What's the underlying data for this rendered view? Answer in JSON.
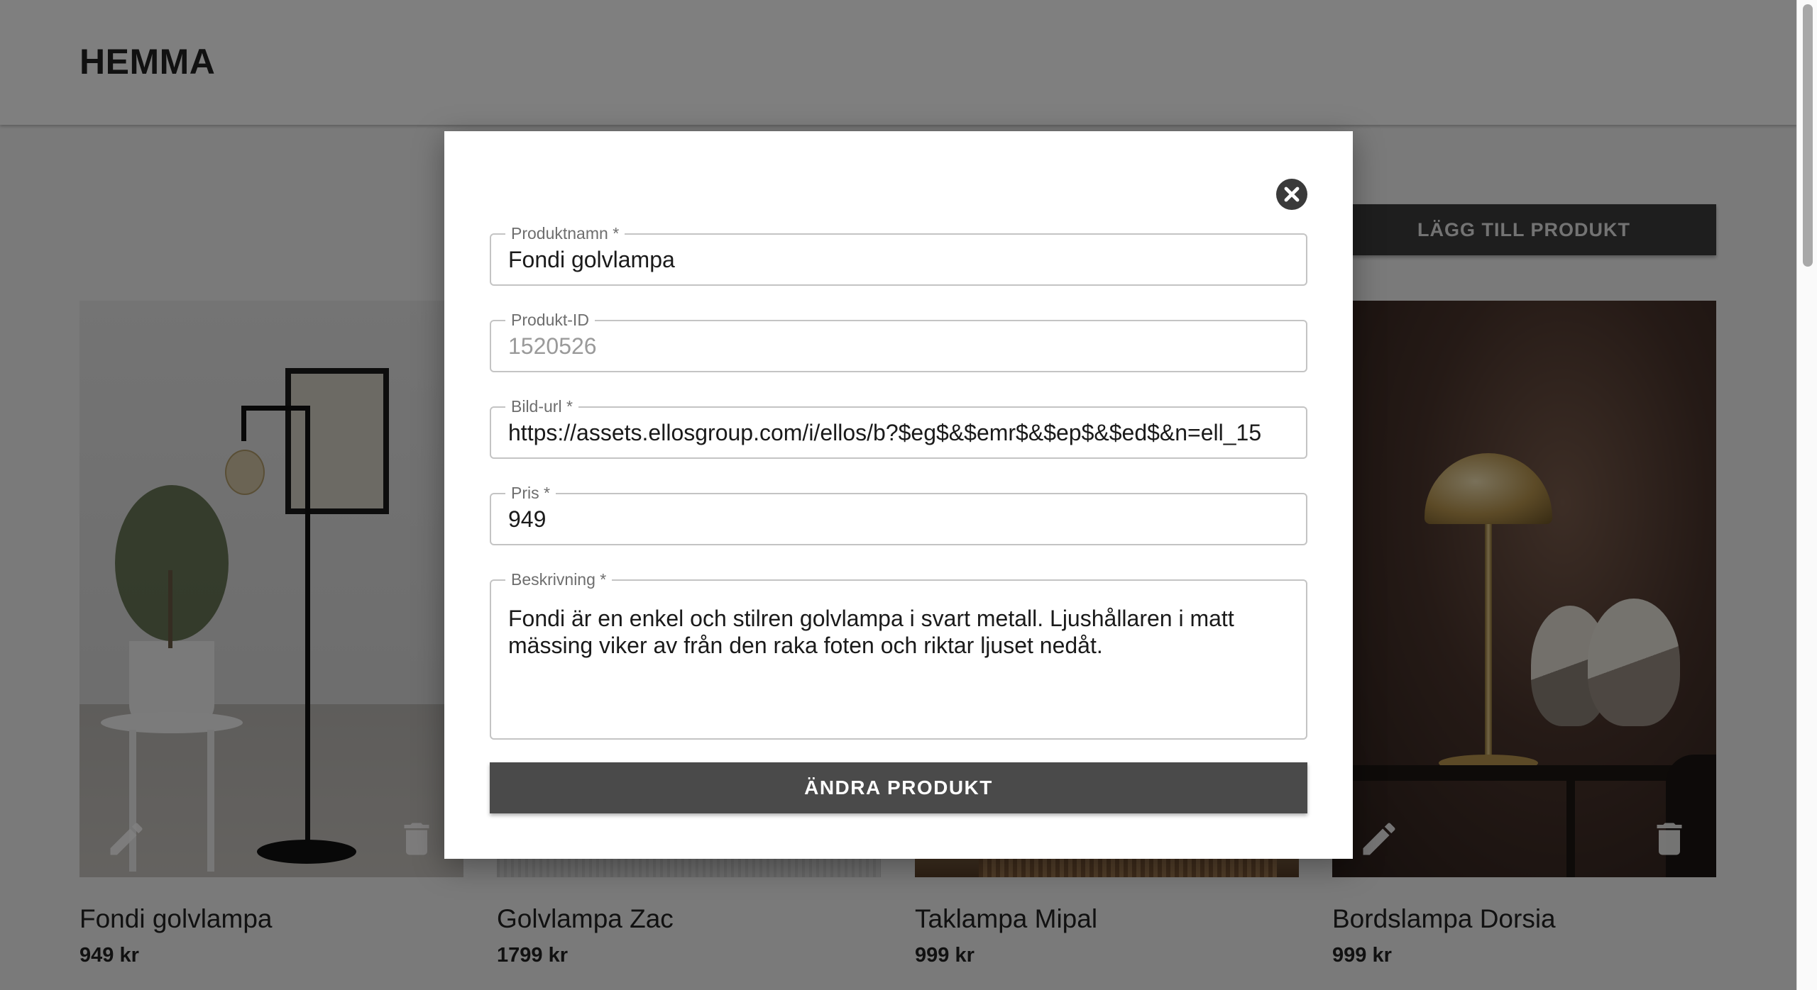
{
  "header": {
    "brand": "HEMMA"
  },
  "toolbar": {
    "add_product_label": "LÄGG TILL PRODUKT"
  },
  "products": [
    {
      "name": "Fondi golvlampa",
      "price": "949 kr"
    },
    {
      "name": "Golvlampa Zac",
      "price": "1799 kr"
    },
    {
      "name": "Taklampa Mipal",
      "price": "999 kr"
    },
    {
      "name": "Bordslampa Dorsia",
      "price": "999 kr"
    }
  ],
  "modal": {
    "fields": {
      "name": {
        "label": "Produktnamn *",
        "value": "Fondi golvlampa"
      },
      "id": {
        "label": "Produkt-ID",
        "value": "1520526"
      },
      "image_url": {
        "label": "Bild-url *",
        "value": "https://assets.ellosgroup.com/i/ellos/b?$eg$&$emr$&$ep$&$ed$&n=ell_15"
      },
      "price": {
        "label": "Pris *",
        "value": "949"
      },
      "description": {
        "label": "Beskrivning *",
        "value": "Fondi är en enkel och stilren golvlampa i svart metall. Ljushållaren i matt mässing viker av från den raka foten och riktar ljuset nedåt."
      }
    },
    "submit_label": "ÄNDRA PRODUKT"
  },
  "icons": {
    "close": "close-circle-icon",
    "edit": "pencil-icon",
    "delete": "trash-icon"
  },
  "colors": {
    "button_dark": "#4a4a4a",
    "overlay": "rgba(0,0,0,0.5)"
  }
}
